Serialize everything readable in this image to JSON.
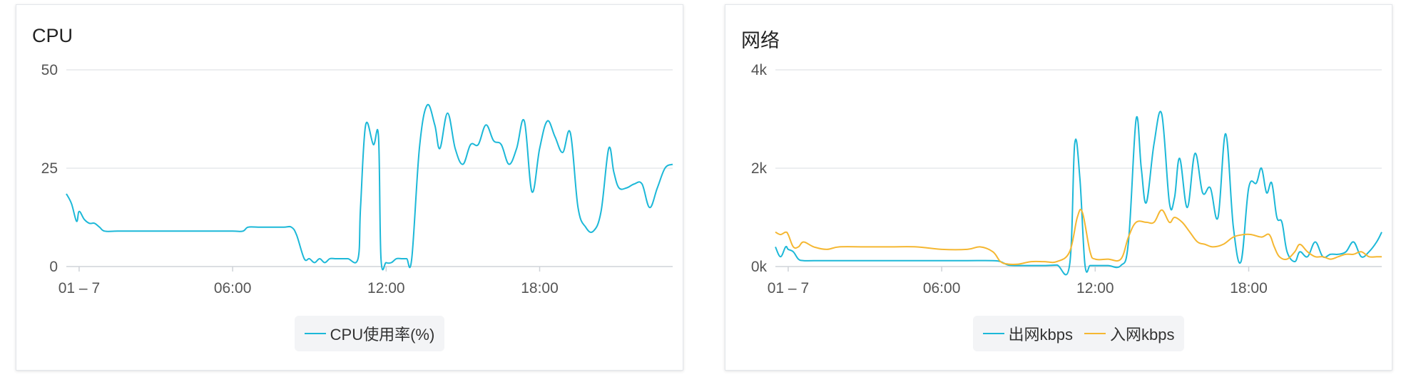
{
  "panels": {
    "cpu": {
      "title": "CPU"
    },
    "net": {
      "title": "网络"
    }
  },
  "chart_data": [
    {
      "type": "line",
      "title": "CPU",
      "ylim": [
        0,
        50
      ],
      "y_ticks": [
        "50",
        "25",
        "0"
      ],
      "y_tick_values": [
        50,
        25,
        0
      ],
      "x_ticks": [
        "01 – 7",
        "06:00",
        "12:00",
        "18:00"
      ],
      "x_tick_hours": [
        0,
        6,
        12,
        18
      ],
      "xlim_hours": [
        -0.5,
        23.2
      ],
      "grid": true,
      "legend_position": "bottom-center",
      "series": [
        {
          "name": "CPU使用率(%)",
          "color": "#1cb8d8",
          "x": [
            -0.5,
            -0.3,
            -0.1,
            0.0,
            0.2,
            0.4,
            0.6,
            0.8,
            1.0,
            1.5,
            2,
            3,
            4,
            5,
            6,
            6.4,
            6.6,
            7,
            7.5,
            8,
            8.3,
            8.5,
            8.8,
            9.0,
            9.2,
            9.4,
            9.6,
            9.8,
            10.0,
            10.2,
            10.5,
            10.9,
            11.0,
            11.2,
            11.5,
            11.7,
            11.8,
            12.0,
            12.2,
            12.4,
            12.6,
            12.8,
            13.0,
            13.3,
            13.6,
            13.9,
            14.1,
            14.4,
            14.7,
            15.0,
            15.3,
            15.6,
            15.9,
            16.2,
            16.5,
            16.8,
            17.1,
            17.4,
            17.7,
            18.0,
            18.3,
            18.6,
            18.9,
            19.2,
            19.5,
            19.8,
            20.1,
            20.4,
            20.7,
            20.9,
            21.1,
            21.4,
            21.7,
            22.0,
            22.3,
            22.6,
            22.9,
            23.2
          ],
          "values": [
            18.5,
            16,
            11.5,
            14,
            12,
            11,
            11,
            10,
            9,
            9,
            9,
            9,
            9,
            9,
            9,
            9,
            10,
            10,
            10,
            10,
            10,
            8,
            2,
            2,
            1,
            2,
            1,
            2,
            2,
            2,
            2,
            2,
            15,
            36,
            31,
            33,
            2,
            1,
            1,
            2,
            2,
            2,
            2,
            30,
            41,
            36,
            30,
            39,
            30,
            26,
            31,
            31,
            36,
            32,
            31,
            26,
            30,
            37,
            19,
            30,
            37,
            33,
            29,
            34,
            15,
            10,
            9,
            14,
            30,
            24,
            20,
            20,
            21,
            21,
            15,
            20,
            25,
            26
          ]
        }
      ]
    },
    {
      "type": "line",
      "title": "网络",
      "ylim": [
        0,
        4000
      ],
      "y_ticks": [
        "4k",
        "2k",
        "0k"
      ],
      "y_tick_values": [
        4000,
        2000,
        0
      ],
      "x_ticks": [
        "01 – 7",
        "06:00",
        "12:00",
        "18:00"
      ],
      "x_tick_hours": [
        0,
        6,
        12,
        18
      ],
      "xlim_hours": [
        -0.5,
        23.2
      ],
      "grid": true,
      "legend_position": "bottom-center",
      "series": [
        {
          "name": "出网kbps",
          "color": "#1cb8d8",
          "x": [
            -0.5,
            -0.3,
            -0.1,
            0.0,
            0.2,
            0.4,
            0.6,
            1,
            2,
            3,
            4,
            5,
            6,
            7,
            8,
            8.3,
            8.6,
            9,
            9.5,
            10,
            10.5,
            11,
            11.2,
            11.4,
            11.6,
            11.8,
            12,
            12.5,
            13,
            13.3,
            13.6,
            13.8,
            14,
            14.3,
            14.6,
            14.9,
            15.1,
            15.3,
            15.6,
            15.9,
            16.2,
            16.5,
            16.8,
            17.1,
            17.4,
            17.7,
            18,
            18.3,
            18.5,
            18.7,
            18.9,
            19.1,
            19.3,
            19.5,
            19.8,
            20,
            20.3,
            20.6,
            20.9,
            21.2,
            21.5,
            21.8,
            22.1,
            22.4,
            22.7,
            23,
            23.2
          ],
          "values": [
            400,
            200,
            400,
            350,
            300,
            150,
            120,
            120,
            120,
            120,
            120,
            120,
            120,
            120,
            120,
            100,
            30,
            20,
            20,
            20,
            30,
            30,
            2500,
            1800,
            30,
            20,
            20,
            20,
            20,
            500,
            3000,
            2000,
            1300,
            2500,
            3100,
            1300,
            1400,
            2200,
            1200,
            2300,
            1500,
            1600,
            1000,
            2700,
            800,
            100,
            1600,
            1700,
            2000,
            1500,
            1700,
            1000,
            900,
            300,
            100,
            300,
            200,
            500,
            200,
            250,
            250,
            300,
            500,
            200,
            300,
            500,
            700
          ]
        },
        {
          "name": "入网kbps",
          "color": "#f5b731",
          "x": [
            -0.5,
            -0.3,
            -0.1,
            0.0,
            0.2,
            0.4,
            0.6,
            1,
            1.5,
            2,
            3,
            4,
            5,
            6,
            7,
            7.5,
            8,
            8.3,
            8.6,
            9,
            9.5,
            10,
            10.5,
            11,
            11.3,
            11.5,
            11.8,
            12,
            12.5,
            13,
            13.3,
            13.6,
            14,
            14.3,
            14.6,
            14.9,
            15.1,
            15.4,
            15.7,
            16,
            16.3,
            16.6,
            17,
            17.4,
            17.8,
            18.1,
            18.5,
            18.8,
            19,
            19.2,
            19.5,
            19.8,
            20,
            20.3,
            20.6,
            20.9,
            21.2,
            21.5,
            21.8,
            22.1,
            22.4,
            22.7,
            23,
            23.2
          ],
          "values": [
            700,
            650,
            700,
            650,
            400,
            400,
            500,
            400,
            350,
            400,
            400,
            400,
            400,
            350,
            350,
            400,
            300,
            100,
            50,
            50,
            100,
            100,
            100,
            300,
            1000,
            1100,
            300,
            150,
            150,
            150,
            600,
            900,
            900,
            900,
            1150,
            900,
            1000,
            900,
            700,
            500,
            450,
            400,
            450,
            600,
            650,
            650,
            600,
            650,
            400,
            200,
            150,
            300,
            450,
            300,
            200,
            200,
            150,
            200,
            250,
            250,
            300,
            200,
            200,
            200
          ]
        }
      ]
    }
  ]
}
